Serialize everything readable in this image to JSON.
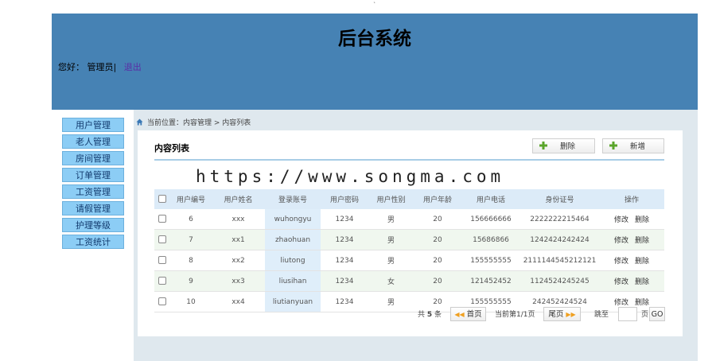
{
  "header": {
    "title": "后台系统",
    "greeting": "您好：",
    "username": "管理员|",
    "logout": "退出"
  },
  "sidebar": {
    "items": [
      {
        "label": "用户管理"
      },
      {
        "label": "老人管理"
      },
      {
        "label": "房间管理"
      },
      {
        "label": "订单管理"
      },
      {
        "label": "工资管理"
      },
      {
        "label": "请假管理"
      },
      {
        "label": "护理等级"
      },
      {
        "label": "工资统计"
      }
    ]
  },
  "breadcrumb": "当前位置：内容管理 > 内容列表",
  "panel": {
    "title": "内容列表",
    "delete_label": "删除",
    "add_label": "新增"
  },
  "watermark": "https://www.songma.com",
  "table": {
    "columns": [
      "用户编号",
      "用户姓名",
      "登录账号",
      "用户密码",
      "用户性别",
      "用户年龄",
      "用户电话",
      "身份证号",
      "操作"
    ],
    "rows": [
      {
        "id": "6",
        "name": "xxx",
        "account": "wuhongyu",
        "password": "1234",
        "gender": "男",
        "age": "20",
        "phone": "156666666",
        "idcard": "2222222215464",
        "edit": "修改",
        "del": "删除"
      },
      {
        "id": "7",
        "name": "xx1",
        "account": "zhaohuan",
        "password": "1234",
        "gender": "男",
        "age": "20",
        "phone": "15686866",
        "idcard": "1242424242424",
        "edit": "修改",
        "del": "删除"
      },
      {
        "id": "8",
        "name": "xx2",
        "account": "liutong",
        "password": "1234",
        "gender": "男",
        "age": "20",
        "phone": "155555555",
        "idcard": "2111144545212121",
        "edit": "修改",
        "del": "删除"
      },
      {
        "id": "9",
        "name": "xx3",
        "account": "liusihan",
        "password": "1234",
        "gender": "女",
        "age": "20",
        "phone": "121452452",
        "idcard": "1124524245245",
        "edit": "修改",
        "del": "删除"
      },
      {
        "id": "10",
        "name": "xx4",
        "account": "liutianyuan",
        "password": "1234",
        "gender": "男",
        "age": "20",
        "phone": "155555555",
        "idcard": "242452424524",
        "edit": "修改",
        "del": "删除"
      }
    ]
  },
  "pager": {
    "total_prefix": "共",
    "total": "5",
    "total_suffix": "条",
    "first": "首页",
    "current": "当前第1/1页",
    "last": "尾页",
    "jump": "跳至",
    "page_unit": "页",
    "go": "GO"
  },
  "colors": {
    "header_bg": "#4682b4",
    "menu_bg": "#8ccdf5",
    "content_bg": "#dfe8ee"
  }
}
